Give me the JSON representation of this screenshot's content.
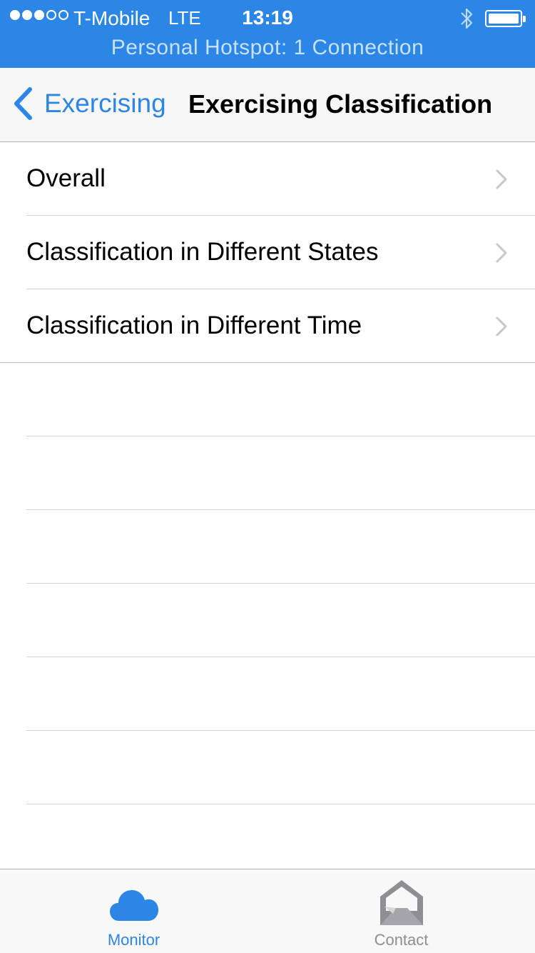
{
  "status_bar": {
    "signal_bars_filled": 3,
    "signal_bars_total": 5,
    "carrier": "T-Mobile",
    "network": "LTE",
    "time": "13:19",
    "hotspot_text": "Personal Hotspot: 1 Connection"
  },
  "nav": {
    "back_label": "Exercising",
    "title": "Exercising Classification"
  },
  "rows": [
    {
      "label": "Overall"
    },
    {
      "label": "Classification in Different States"
    },
    {
      "label": "Classification in Different Time"
    }
  ],
  "tabs": [
    {
      "label": "Monitor",
      "icon": "cloud-icon",
      "active": true
    },
    {
      "label": "Contact",
      "icon": "envelope-icon",
      "active": false
    }
  ],
  "colors": {
    "accent": "#2b86e6",
    "status_bar_bg": "#2b86e6",
    "inactive_tab": "#8e8e93"
  }
}
